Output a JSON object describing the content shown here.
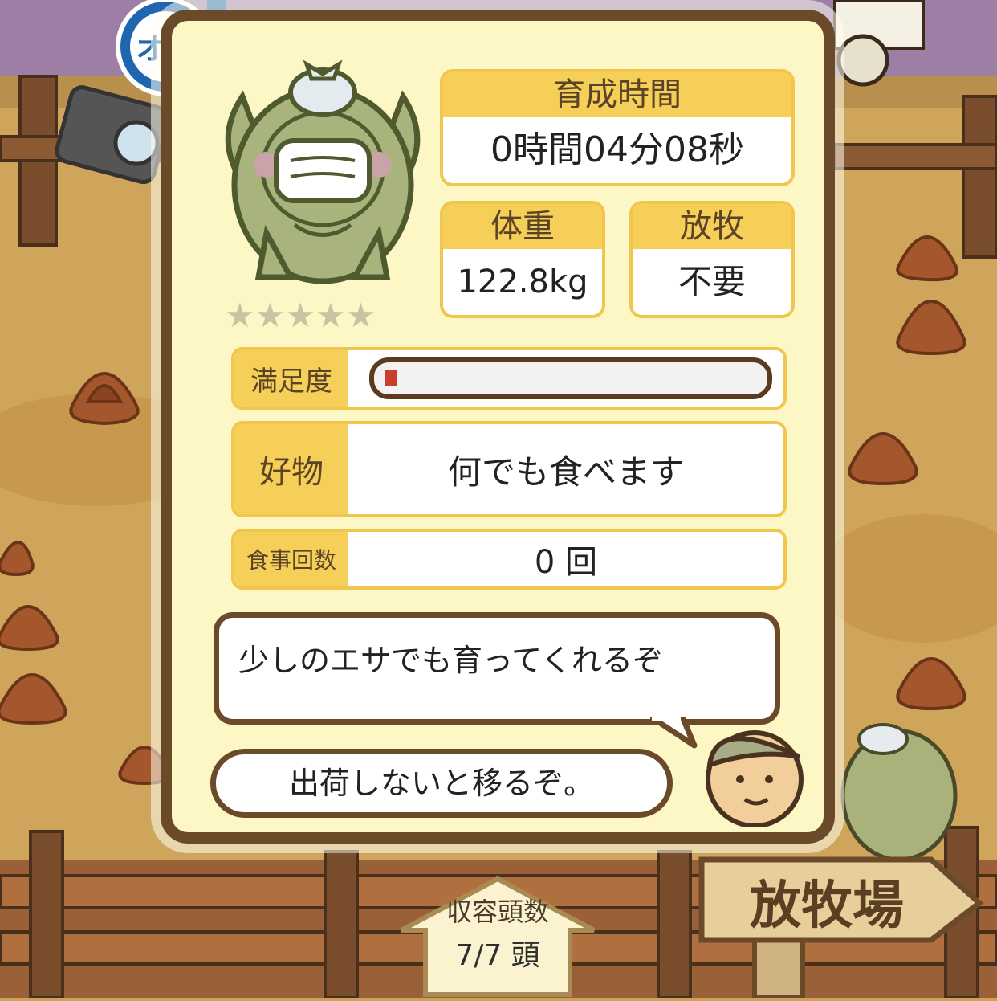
{
  "gender_badge": {
    "label": "オス",
    "icon": "male-symbol-icon",
    "color": "#1f66b1"
  },
  "pig": {
    "icon": "masked-pig-icon",
    "stars": 5,
    "stars_filled": 0
  },
  "stats": {
    "growth_time": {
      "label": "育成時間",
      "value": "0時間04分08秒"
    },
    "weight": {
      "label": "体重",
      "value": "122.8kg"
    },
    "grazing": {
      "label": "放牧",
      "value": "不要"
    }
  },
  "satisfaction": {
    "label": "満足度",
    "level": 0.03,
    "bar_color": "#c8402c"
  },
  "favorite_food": {
    "label": "好物",
    "value": "何でも食べます"
  },
  "meal_count": {
    "label": "食事回数",
    "value": "0 回"
  },
  "speech": {
    "line1": "少しのエサでも育ってくれるぞ",
    "line2": "出荷しないと移るぞ。"
  },
  "capacity": {
    "label": "収容頭数",
    "value": "7/7 頭"
  },
  "pasture_sign": {
    "label": "放牧場"
  },
  "colors": {
    "accent": "#f5cf57",
    "frame": "#6b4a2a",
    "panel": "#fdf7c6"
  }
}
